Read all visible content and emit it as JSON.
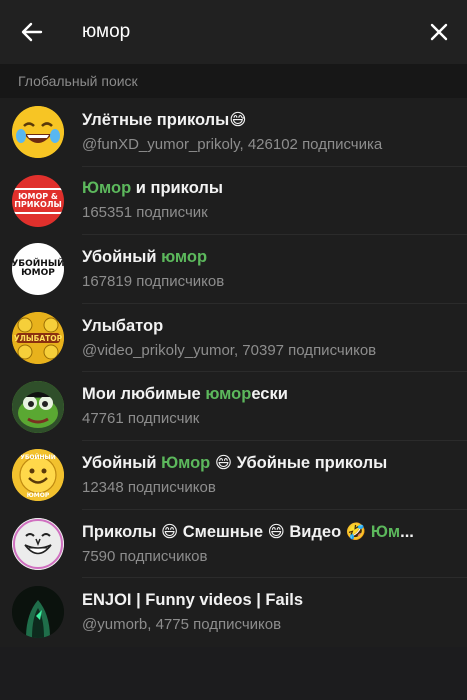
{
  "search": {
    "query": "юмор"
  },
  "section": {
    "title": "Глобальный поиск"
  },
  "results": [
    {
      "title_parts": [
        {
          "text": "Улётные приколы",
          "hl": false
        },
        {
          "text": "😅",
          "hl": false
        }
      ],
      "subtitle": "@funXD_yumor_prikoly, 426102 подписчика",
      "avatar": {
        "kind": "laughing-emoji-icon",
        "bg": "#f5c518"
      }
    },
    {
      "title_parts": [
        {
          "text": "Юмор",
          "hl": true
        },
        {
          "text": " и приколы",
          "hl": false
        }
      ],
      "subtitle": "165351 подписчик",
      "avatar": {
        "kind": "text-logo",
        "bg": "#e0302c",
        "text": "ЮМОР & ПРИКОЛЫ"
      }
    },
    {
      "title_parts": [
        {
          "text": "Убойный ",
          "hl": false
        },
        {
          "text": "юмор",
          "hl": true
        }
      ],
      "subtitle": "167819 подписчиков",
      "avatar": {
        "kind": "text-logo",
        "bg": "#ffffff",
        "text": "УБОЙНЫЙ ЮМОР"
      }
    },
    {
      "title_parts": [
        {
          "text": "Улыбатор",
          "hl": false
        }
      ],
      "subtitle": "@video_prikoly_yumor, 70397 подписчиков",
      "avatar": {
        "kind": "smileys-logo",
        "bg": "#e8b21c",
        "text": "УЛЫБАТОР"
      }
    },
    {
      "title_parts": [
        {
          "text": "Мои любимые ",
          "hl": false
        },
        {
          "text": "юмор",
          "hl": true
        },
        {
          "text": "ески",
          "hl": false
        }
      ],
      "subtitle": "47761 подписчик",
      "avatar": {
        "kind": "frog-icon",
        "bg": "#5aa832"
      }
    },
    {
      "title_parts": [
        {
          "text": "Убойный ",
          "hl": false
        },
        {
          "text": "Юмор",
          "hl": true
        },
        {
          "text": " 😄 Убойные приколы",
          "hl": false
        }
      ],
      "subtitle": "12348 подписчиков",
      "avatar": {
        "kind": "smiley-logo",
        "bg": "#f2c12e",
        "text": "УБОЙНЫЙ ЮМОР"
      }
    },
    {
      "title_parts": [
        {
          "text": "Приколы 😄 Смешные 😄 Видео 🤣 ",
          "hl": false
        },
        {
          "text": "Юм",
          "hl": true
        },
        {
          "text": "...",
          "hl": false
        }
      ],
      "subtitle": "7590 подписчиков",
      "avatar": {
        "kind": "meme-face-icon",
        "bg": "#e9e9e9"
      }
    },
    {
      "title_parts": [
        {
          "text": "ENJOI | Funny videos | Fails",
          "hl": false
        }
      ],
      "subtitle": "@yumorb, 4775 подписчиков",
      "avatar": {
        "kind": "hooded-figure-icon",
        "bg": "#0b120d"
      }
    }
  ],
  "colors": {
    "highlight": "#5cb85c",
    "background": "#1e1e1e",
    "topbar": "#212121",
    "section": "#171717"
  }
}
